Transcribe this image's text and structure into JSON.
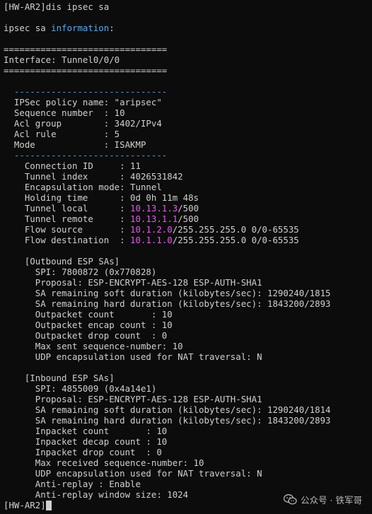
{
  "prompt_line": {
    "prompt": "[HW-AR2]",
    "command": "dis ipsec sa"
  },
  "header": {
    "prefix": "ipsec sa ",
    "keyword": "information",
    "suffix": ":"
  },
  "separator": "===============================",
  "interface_line": "Interface: Tunnel0/0/0",
  "policy_rule": "-----------------------------",
  "policy": {
    "name_row": "IPSec policy name: \"aripsec\"",
    "seq_row": "Sequence number  : 10",
    "acl_group_row": "Acl group        : 3402/IPv4",
    "acl_rule_row": "Acl rule         : 5",
    "mode_row": "Mode             : ISAKMP"
  },
  "connection": {
    "connection_id": "Connection ID     : 11",
    "tunnel_index": "Tunnel index      : 4026531842",
    "encap_mode": "Encapsulation mode: Tunnel",
    "holding_time": "Holding time      : 0d 0h 11m 48s",
    "tunnel_local_label": "Tunnel local      : ",
    "tunnel_local_ip": "10.13.1.3",
    "tunnel_local_port": "/500",
    "tunnel_remote_label": "Tunnel remote     : ",
    "tunnel_remote_ip": "10.13.1.1",
    "tunnel_remote_port": "/500",
    "flow_source_label": "Flow source       : ",
    "flow_source_ip": "10.1.2.0",
    "flow_source_rest": "/255.255.255.0 0/0-65535",
    "flow_dest_label": "Flow destination  : ",
    "flow_dest_ip": "10.1.1.0",
    "flow_dest_rest": "/255.255.255.0 0/0-65535"
  },
  "outbound": {
    "title": "[Outbound ESP SAs]",
    "spi": "SPI: 7800872 (0x770828)",
    "proposal": "Proposal: ESP-ENCRYPT-AES-128 ESP-AUTH-SHA1",
    "soft": "SA remaining soft duration (kilobytes/sec): 1290240/1815",
    "hard": "SA remaining hard duration (kilobytes/sec): 1843200/2893",
    "count": "Outpacket count       : 10",
    "encap": "Outpacket encap count : 10",
    "drop": "Outpacket drop count  : 0",
    "max_seq": "Max sent sequence-number: 10",
    "udp": "UDP encapsulation used for NAT traversal: N"
  },
  "inbound": {
    "title": "[Inbound ESP SAs]",
    "spi": "SPI: 4855009 (0x4a14e1)",
    "proposal": "Proposal: ESP-ENCRYPT-AES-128 ESP-AUTH-SHA1",
    "soft": "SA remaining soft duration (kilobytes/sec): 1290240/1814",
    "hard": "SA remaining hard duration (kilobytes/sec): 1843200/2893",
    "count": "Inpacket count       : 10",
    "decap": "Inpacket decap count : 10",
    "drop": "Inpacket drop count  : 0",
    "max_seq": "Max received sequence-number: 10",
    "udp": "UDP encapsulation used for NAT traversal: N",
    "anti_replay": "Anti-replay : Enable",
    "anti_replay_window": "Anti-replay window size: 1024"
  },
  "final_prompt": "[HW-AR2]",
  "watermark": {
    "text": "公众号 · 铁军哥",
    "icon": "wechat-icon"
  },
  "colors": {
    "background": "#0c0c0c",
    "text": "#d0d0d0",
    "keyword": "#5fa8e8",
    "ip_highlight": "#e05ce8",
    "dash_rule": "#4a9fe0"
  }
}
